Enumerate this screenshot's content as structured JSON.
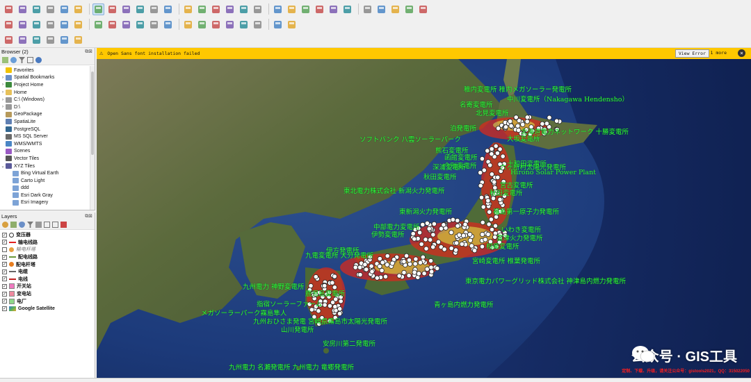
{
  "toolbars": {
    "row1": [
      "new-project-icon",
      "open-folder-icon",
      "save-icon",
      "save-as-icon",
      "print-layout-icon",
      "layout-manager-icon",
      "pan-icon",
      "pan-to-selection-icon",
      "zoom-in-icon",
      "zoom-out-icon",
      "zoom-full-icon",
      "zoom-layer-icon",
      "zoom-selection-icon",
      "zoom-last-icon",
      "zoom-next-icon",
      "new-map-view-icon",
      "temporal-icon",
      "refresh-icon",
      "select-icon",
      "deselect-icon",
      "select-attribute-icon",
      "identify-icon",
      "attribute-table-icon",
      "processing-icon",
      "statistics-icon",
      "field-calc-icon",
      "measure-icon",
      "annotation-icon",
      "map-tips-icon"
    ],
    "row2": [
      "digitize-icon",
      "edit-pencil-icon",
      "vertex-tool-icon",
      "add-feature-icon",
      "move-feature-icon",
      "delete-icon",
      "cut-icon",
      "copy-icon",
      "paste-icon",
      "undo-icon",
      "redo-icon",
      "label-icon",
      "label-pin-icon",
      "label-show-icon",
      "label-move-icon",
      "label-rotate-icon",
      "label-change-icon",
      "diagram-icon",
      "python-icon",
      "metasearch-icon"
    ],
    "row3": [
      "add-point-icon",
      "georef-icon",
      "search-icon",
      "plugin-icon",
      "globe-icon",
      "wrench-icon"
    ]
  },
  "browser": {
    "title": "Browser (2)",
    "items": [
      {
        "label": "Favorites",
        "icon": "star-icon",
        "color": "#f2c300",
        "child": false,
        "arrow": ""
      },
      {
        "label": "Spatial Bookmarks",
        "icon": "bookmark-icon",
        "color": "#6a8fc7",
        "child": false,
        "arrow": "›"
      },
      {
        "label": "Project Home",
        "icon": "folder-icon",
        "color": "#3c8a3c",
        "child": false,
        "arrow": "›"
      },
      {
        "label": "Home",
        "icon": "folder-icon",
        "color": "#e7c15a",
        "child": false,
        "arrow": "›"
      },
      {
        "label": "C:\\ (Windows)",
        "icon": "drive-icon",
        "color": "#999999",
        "child": false,
        "arrow": "›"
      },
      {
        "label": "D:\\",
        "icon": "drive-icon",
        "color": "#999999",
        "child": false,
        "arrow": "›"
      },
      {
        "label": "GeoPackage",
        "icon": "geopackage-icon",
        "color": "#b79a5b",
        "child": false,
        "arrow": ""
      },
      {
        "label": "SpatiaLite",
        "icon": "spatialite-icon",
        "color": "#5f7fb3",
        "child": false,
        "arrow": ""
      },
      {
        "label": "PostgreSQL",
        "icon": "postgresql-icon",
        "color": "#336791",
        "child": false,
        "arrow": ""
      },
      {
        "label": "MS SQL Server",
        "icon": "mssql-icon",
        "color": "#6a6a6a",
        "child": false,
        "arrow": ""
      },
      {
        "label": "WMS/WMTS",
        "icon": "wms-icon",
        "color": "#4a86c5",
        "child": false,
        "arrow": ""
      },
      {
        "label": "Scenes",
        "icon": "scenes-icon",
        "color": "#9a5ac4",
        "child": false,
        "arrow": ""
      },
      {
        "label": "Vector Tiles",
        "icon": "vector-tiles-icon",
        "color": "#555555",
        "child": false,
        "arrow": ""
      },
      {
        "label": "XYZ Tiles",
        "icon": "xyz-tiles-icon",
        "color": "#5a5a9a",
        "child": false,
        "arrow": "⌄"
      },
      {
        "label": "Bing Virtual Earth",
        "icon": "grid-icon",
        "color": "#7da3d6",
        "child": true,
        "arrow": ""
      },
      {
        "label": "Carto Light",
        "icon": "grid-icon",
        "color": "#7da3d6",
        "child": true,
        "arrow": ""
      },
      {
        "label": "ddd",
        "icon": "grid-icon",
        "color": "#7da3d6",
        "child": true,
        "arrow": ""
      },
      {
        "label": "Esri Dark Gray",
        "icon": "grid-icon",
        "color": "#7da3d6",
        "child": true,
        "arrow": ""
      },
      {
        "label": "Esri Imagery",
        "icon": "grid-icon",
        "color": "#7da3d6",
        "child": true,
        "arrow": ""
      }
    ]
  },
  "layers": {
    "title": "Layers",
    "items": [
      {
        "label": "变压器",
        "checked": true,
        "symbol": "circle",
        "color": "#ffffff",
        "style": "bold"
      },
      {
        "label": "输电线路",
        "checked": true,
        "symbol": "line",
        "color": "#e02020",
        "style": "bold"
      },
      {
        "label": "输电杆塔",
        "checked": false,
        "symbol": "dot",
        "color": "#e8a040",
        "style": "italic"
      },
      {
        "label": "配电线路",
        "checked": true,
        "symbol": "line",
        "color": "#6a9a3a",
        "style": "bold"
      },
      {
        "label": "配电杆塔",
        "checked": true,
        "symbol": "dot",
        "color": "#e87e20",
        "style": "bold"
      },
      {
        "label": "电缆",
        "checked": true,
        "symbol": "dash",
        "color": "#666666",
        "style": "bold"
      },
      {
        "label": "电线",
        "checked": true,
        "symbol": "line",
        "color": "#c02020",
        "style": "bold"
      },
      {
        "label": "开关站",
        "checked": true,
        "symbol": "square",
        "color": "#f07ac0",
        "style": "bold"
      },
      {
        "label": "变电站",
        "checked": true,
        "symbol": "square",
        "color": "#f08aa0",
        "style": "bold"
      },
      {
        "label": "电厂",
        "checked": true,
        "symbol": "square",
        "color": "#8fd88a",
        "style": "bold"
      },
      {
        "label": "Google Satellite",
        "checked": true,
        "symbol": "raster",
        "color": "#3a7ad0",
        "style": "bold"
      }
    ]
  },
  "message": {
    "text": "Open Sans font installation failed",
    "view_error": "View Error",
    "more": "1 more"
  },
  "map_labels": [
    {
      "text": "稚内変電所 稚内メガソーラー発電所"
    },
    {
      "text": "中川変電所（Nakagawa Hendensho）"
    },
    {
      "text": "名寄変電所"
    },
    {
      "text": "北見変電所"
    },
    {
      "text": "泊発電所"
    },
    {
      "text": "北海道電力ネットワーク 十勝変電所"
    },
    {
      "text": "大坂変電所"
    },
    {
      "text": "ソフトバンク 八雲ソーラーパーク"
    },
    {
      "text": "熊石変電所"
    },
    {
      "text": "函館変電所"
    },
    {
      "text": "今別変電所"
    },
    {
      "text": "十和田変電所"
    },
    {
      "text": "深浦変電所"
    },
    {
      "text": "六ヶ所村太陽光発電所"
    },
    {
      "text": "Hirono Solar Power Plant"
    },
    {
      "text": "秋田変電所"
    },
    {
      "text": "宮古変電所"
    },
    {
      "text": "東北電力株式会社 新潟火力発電所"
    },
    {
      "text": "秋田変電所"
    },
    {
      "text": "東新潟火力発電所"
    },
    {
      "text": "福島第一原子力発電所"
    },
    {
      "text": "中部電力変電所"
    },
    {
      "text": "いわき変電所"
    },
    {
      "text": "伊勢変電所"
    },
    {
      "text": "富津火力発電所"
    },
    {
      "text": "相楽変電所"
    },
    {
      "text": "伊方発電所"
    },
    {
      "text": "九電変電所 大分発電所"
    },
    {
      "text": "宮崎変電所 椎葉発電所"
    },
    {
      "text": "東京電力パワーグリッド株式会社 神津島内燃力発電所"
    },
    {
      "text": "青ヶ島内燃力発電所"
    },
    {
      "text": "鹿児島変電所"
    },
    {
      "text": "九州電力 神野変電所"
    },
    {
      "text": "指宿ソーラーファーム"
    },
    {
      "text": "メガソーラーパーク霧島隼人"
    },
    {
      "text": "九州おひさま発電 宮崎県霧島市太陽光発電所"
    },
    {
      "text": "山川発電所"
    },
    {
      "text": "安房川第二発電所"
    },
    {
      "text": "九州電力 名瀬発電所 九州電力 竜郷発電所"
    }
  ],
  "watermark": {
    "text": "公众号 · GIS工具"
  },
  "credit": {
    "text": "定制、下载、升级，请关注公众号：gistools2021，QQ：315022050"
  }
}
